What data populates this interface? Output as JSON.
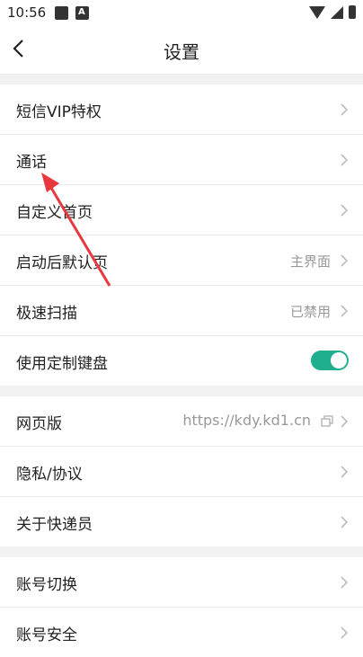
{
  "status_bar": {
    "time": "10:56",
    "badge": "A"
  },
  "header": {
    "title": "设置"
  },
  "groups": [
    {
      "items": [
        {
          "label": "短信VIP特权"
        },
        {
          "label": "通话"
        },
        {
          "label": "自定义首页"
        },
        {
          "label": "启动后默认页",
          "value": "主界面"
        },
        {
          "label": "极速扫描",
          "value": "已禁用"
        },
        {
          "label": "使用定制键盘",
          "toggle": true
        }
      ]
    },
    {
      "items": [
        {
          "label": "网页版",
          "value": "https://kdy.kd1.cn"
        },
        {
          "label": "隐私/协议"
        },
        {
          "label": "关于快递员"
        }
      ]
    },
    {
      "items": [
        {
          "label": "账号切换"
        },
        {
          "label": "账号安全"
        }
      ]
    }
  ],
  "colors": {
    "toggle_on": "#1fae8e",
    "annotation_arrow": "#e8383d"
  }
}
